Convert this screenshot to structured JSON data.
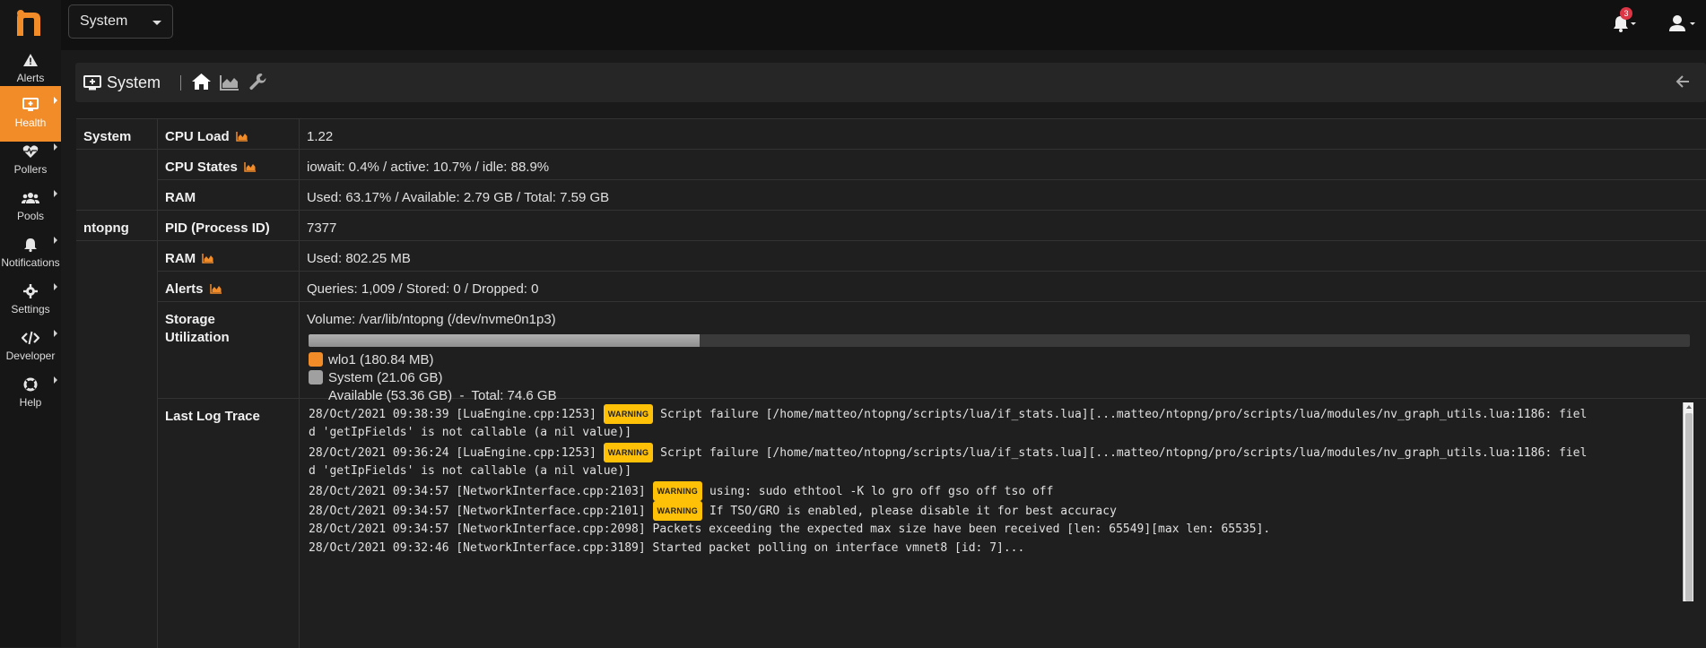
{
  "app": {
    "brand_color": "#f28c28"
  },
  "topbar": {
    "interface_select": "System",
    "notifications_count": "3"
  },
  "sidebar": {
    "items": [
      {
        "label": "Alerts",
        "icon": "warning-icon"
      },
      {
        "label": "Health",
        "icon": "monitor-icon",
        "active": true
      },
      {
        "label": "Pollers",
        "icon": "heartbeat-icon"
      },
      {
        "label": "Pools",
        "icon": "users-icon"
      },
      {
        "label": "Notifications",
        "icon": "bell-icon"
      },
      {
        "label": "Settings",
        "icon": "gear-icon"
      },
      {
        "label": "Developer",
        "icon": "code-icon"
      },
      {
        "label": "Help",
        "icon": "lifebuoy-icon"
      }
    ]
  },
  "page": {
    "title": "System"
  },
  "table": {
    "system_section": "System",
    "ntopng_section": "ntopng",
    "cpu_load_label": "CPU Load",
    "cpu_load_value": "1.22",
    "cpu_states_label": "CPU States",
    "cpu_states_value": "iowait: 0.4% / active: 10.7% / idle: 88.9%",
    "ram_label": "RAM",
    "ram_value": "Used: 63.17% / Available: 2.79 GB / Total: 7.59 GB",
    "pid_label": "PID (Process ID)",
    "pid_value": "7377",
    "ntopng_ram_label": "RAM",
    "ntopng_ram_value": "Used: 802.25 MB",
    "alerts_label": "Alerts",
    "alerts_value": "Queries: 1,009 / Stored: 0 / Dropped: 0",
    "storage_label_1": "Storage",
    "storage_label_2": "Utilization",
    "storage_volume": "Volume: /var/lib/ntopng (/dev/nvme0n1p3)",
    "storage_used_fraction": 0.283,
    "legend_wlo1": "wlo1 (180.84 MB)",
    "legend_system": "System (21.06 GB)",
    "legend_available": "Available (53.36 GB)  -  Total: 74.6 GB",
    "wlo1_color": "#f28c28",
    "system_color": "#a0a0a0",
    "log_label": "Last Log Trace"
  },
  "log": [
    {
      "ts": "28/Oct/2021 09:38:39 [LuaEngine.cpp:1253]",
      "level": "WARNING",
      "msg": "Script failure [/home/matteo/ntopng/scripts/lua/if_stats.lua][...matteo/ntopng/pro/scripts/lua/modules/nv_graph_utils.lua:1186: fiel",
      "cont": "d 'getIpFields' is not callable (a nil value)]"
    },
    {
      "ts": "28/Oct/2021 09:36:24 [LuaEngine.cpp:1253]",
      "level": "WARNING",
      "msg": "Script failure [/home/matteo/ntopng/scripts/lua/if_stats.lua][...matteo/ntopng/pro/scripts/lua/modules/nv_graph_utils.lua:1186: fiel",
      "cont": "d 'getIpFields' is not callable (a nil value)]"
    },
    {
      "ts": "28/Oct/2021 09:34:57 [NetworkInterface.cpp:2103]",
      "level": "WARNING",
      "msg": "using: sudo ethtool -K lo gro off gso off tso off"
    },
    {
      "ts": "28/Oct/2021 09:34:57 [NetworkInterface.cpp:2101]",
      "level": "WARNING",
      "msg": "If TSO/GRO is enabled, please disable it for best accuracy"
    },
    {
      "ts": "28/Oct/2021 09:34:57 [NetworkInterface.cpp:2098]",
      "level": "",
      "msg": "Packets exceeding the expected max size have been received [len: 65549][max len: 65535]."
    },
    {
      "ts": "28/Oct/2021 09:32:46 [NetworkInterface.cpp:3189]",
      "level": "",
      "msg": "Started packet polling on interface vmnet8 [id: 7]..."
    }
  ]
}
